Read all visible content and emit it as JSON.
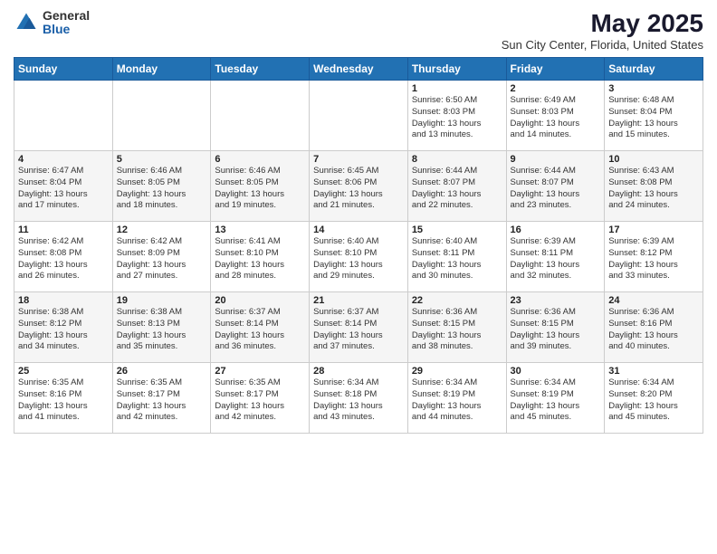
{
  "header": {
    "logo_general": "General",
    "logo_blue": "Blue",
    "main_title": "May 2025",
    "subtitle": "Sun City Center, Florida, United States"
  },
  "calendar": {
    "days_of_week": [
      "Sunday",
      "Monday",
      "Tuesday",
      "Wednesday",
      "Thursday",
      "Friday",
      "Saturday"
    ],
    "weeks": [
      [
        {
          "day": "",
          "info": ""
        },
        {
          "day": "",
          "info": ""
        },
        {
          "day": "",
          "info": ""
        },
        {
          "day": "",
          "info": ""
        },
        {
          "day": "1",
          "info": "Sunrise: 6:50 AM\nSunset: 8:03 PM\nDaylight: 13 hours\nand 13 minutes."
        },
        {
          "day": "2",
          "info": "Sunrise: 6:49 AM\nSunset: 8:03 PM\nDaylight: 13 hours\nand 14 minutes."
        },
        {
          "day": "3",
          "info": "Sunrise: 6:48 AM\nSunset: 8:04 PM\nDaylight: 13 hours\nand 15 minutes."
        }
      ],
      [
        {
          "day": "4",
          "info": "Sunrise: 6:47 AM\nSunset: 8:04 PM\nDaylight: 13 hours\nand 17 minutes."
        },
        {
          "day": "5",
          "info": "Sunrise: 6:46 AM\nSunset: 8:05 PM\nDaylight: 13 hours\nand 18 minutes."
        },
        {
          "day": "6",
          "info": "Sunrise: 6:46 AM\nSunset: 8:05 PM\nDaylight: 13 hours\nand 19 minutes."
        },
        {
          "day": "7",
          "info": "Sunrise: 6:45 AM\nSunset: 8:06 PM\nDaylight: 13 hours\nand 21 minutes."
        },
        {
          "day": "8",
          "info": "Sunrise: 6:44 AM\nSunset: 8:07 PM\nDaylight: 13 hours\nand 22 minutes."
        },
        {
          "day": "9",
          "info": "Sunrise: 6:44 AM\nSunset: 8:07 PM\nDaylight: 13 hours\nand 23 minutes."
        },
        {
          "day": "10",
          "info": "Sunrise: 6:43 AM\nSunset: 8:08 PM\nDaylight: 13 hours\nand 24 minutes."
        }
      ],
      [
        {
          "day": "11",
          "info": "Sunrise: 6:42 AM\nSunset: 8:08 PM\nDaylight: 13 hours\nand 26 minutes."
        },
        {
          "day": "12",
          "info": "Sunrise: 6:42 AM\nSunset: 8:09 PM\nDaylight: 13 hours\nand 27 minutes."
        },
        {
          "day": "13",
          "info": "Sunrise: 6:41 AM\nSunset: 8:10 PM\nDaylight: 13 hours\nand 28 minutes."
        },
        {
          "day": "14",
          "info": "Sunrise: 6:40 AM\nSunset: 8:10 PM\nDaylight: 13 hours\nand 29 minutes."
        },
        {
          "day": "15",
          "info": "Sunrise: 6:40 AM\nSunset: 8:11 PM\nDaylight: 13 hours\nand 30 minutes."
        },
        {
          "day": "16",
          "info": "Sunrise: 6:39 AM\nSunset: 8:11 PM\nDaylight: 13 hours\nand 32 minutes."
        },
        {
          "day": "17",
          "info": "Sunrise: 6:39 AM\nSunset: 8:12 PM\nDaylight: 13 hours\nand 33 minutes."
        }
      ],
      [
        {
          "day": "18",
          "info": "Sunrise: 6:38 AM\nSunset: 8:12 PM\nDaylight: 13 hours\nand 34 minutes."
        },
        {
          "day": "19",
          "info": "Sunrise: 6:38 AM\nSunset: 8:13 PM\nDaylight: 13 hours\nand 35 minutes."
        },
        {
          "day": "20",
          "info": "Sunrise: 6:37 AM\nSunset: 8:14 PM\nDaylight: 13 hours\nand 36 minutes."
        },
        {
          "day": "21",
          "info": "Sunrise: 6:37 AM\nSunset: 8:14 PM\nDaylight: 13 hours\nand 37 minutes."
        },
        {
          "day": "22",
          "info": "Sunrise: 6:36 AM\nSunset: 8:15 PM\nDaylight: 13 hours\nand 38 minutes."
        },
        {
          "day": "23",
          "info": "Sunrise: 6:36 AM\nSunset: 8:15 PM\nDaylight: 13 hours\nand 39 minutes."
        },
        {
          "day": "24",
          "info": "Sunrise: 6:36 AM\nSunset: 8:16 PM\nDaylight: 13 hours\nand 40 minutes."
        }
      ],
      [
        {
          "day": "25",
          "info": "Sunrise: 6:35 AM\nSunset: 8:16 PM\nDaylight: 13 hours\nand 41 minutes."
        },
        {
          "day": "26",
          "info": "Sunrise: 6:35 AM\nSunset: 8:17 PM\nDaylight: 13 hours\nand 42 minutes."
        },
        {
          "day": "27",
          "info": "Sunrise: 6:35 AM\nSunset: 8:17 PM\nDaylight: 13 hours\nand 42 minutes."
        },
        {
          "day": "28",
          "info": "Sunrise: 6:34 AM\nSunset: 8:18 PM\nDaylight: 13 hours\nand 43 minutes."
        },
        {
          "day": "29",
          "info": "Sunrise: 6:34 AM\nSunset: 8:19 PM\nDaylight: 13 hours\nand 44 minutes."
        },
        {
          "day": "30",
          "info": "Sunrise: 6:34 AM\nSunset: 8:19 PM\nDaylight: 13 hours\nand 45 minutes."
        },
        {
          "day": "31",
          "info": "Sunrise: 6:34 AM\nSunset: 8:20 PM\nDaylight: 13 hours\nand 45 minutes."
        }
      ]
    ]
  }
}
